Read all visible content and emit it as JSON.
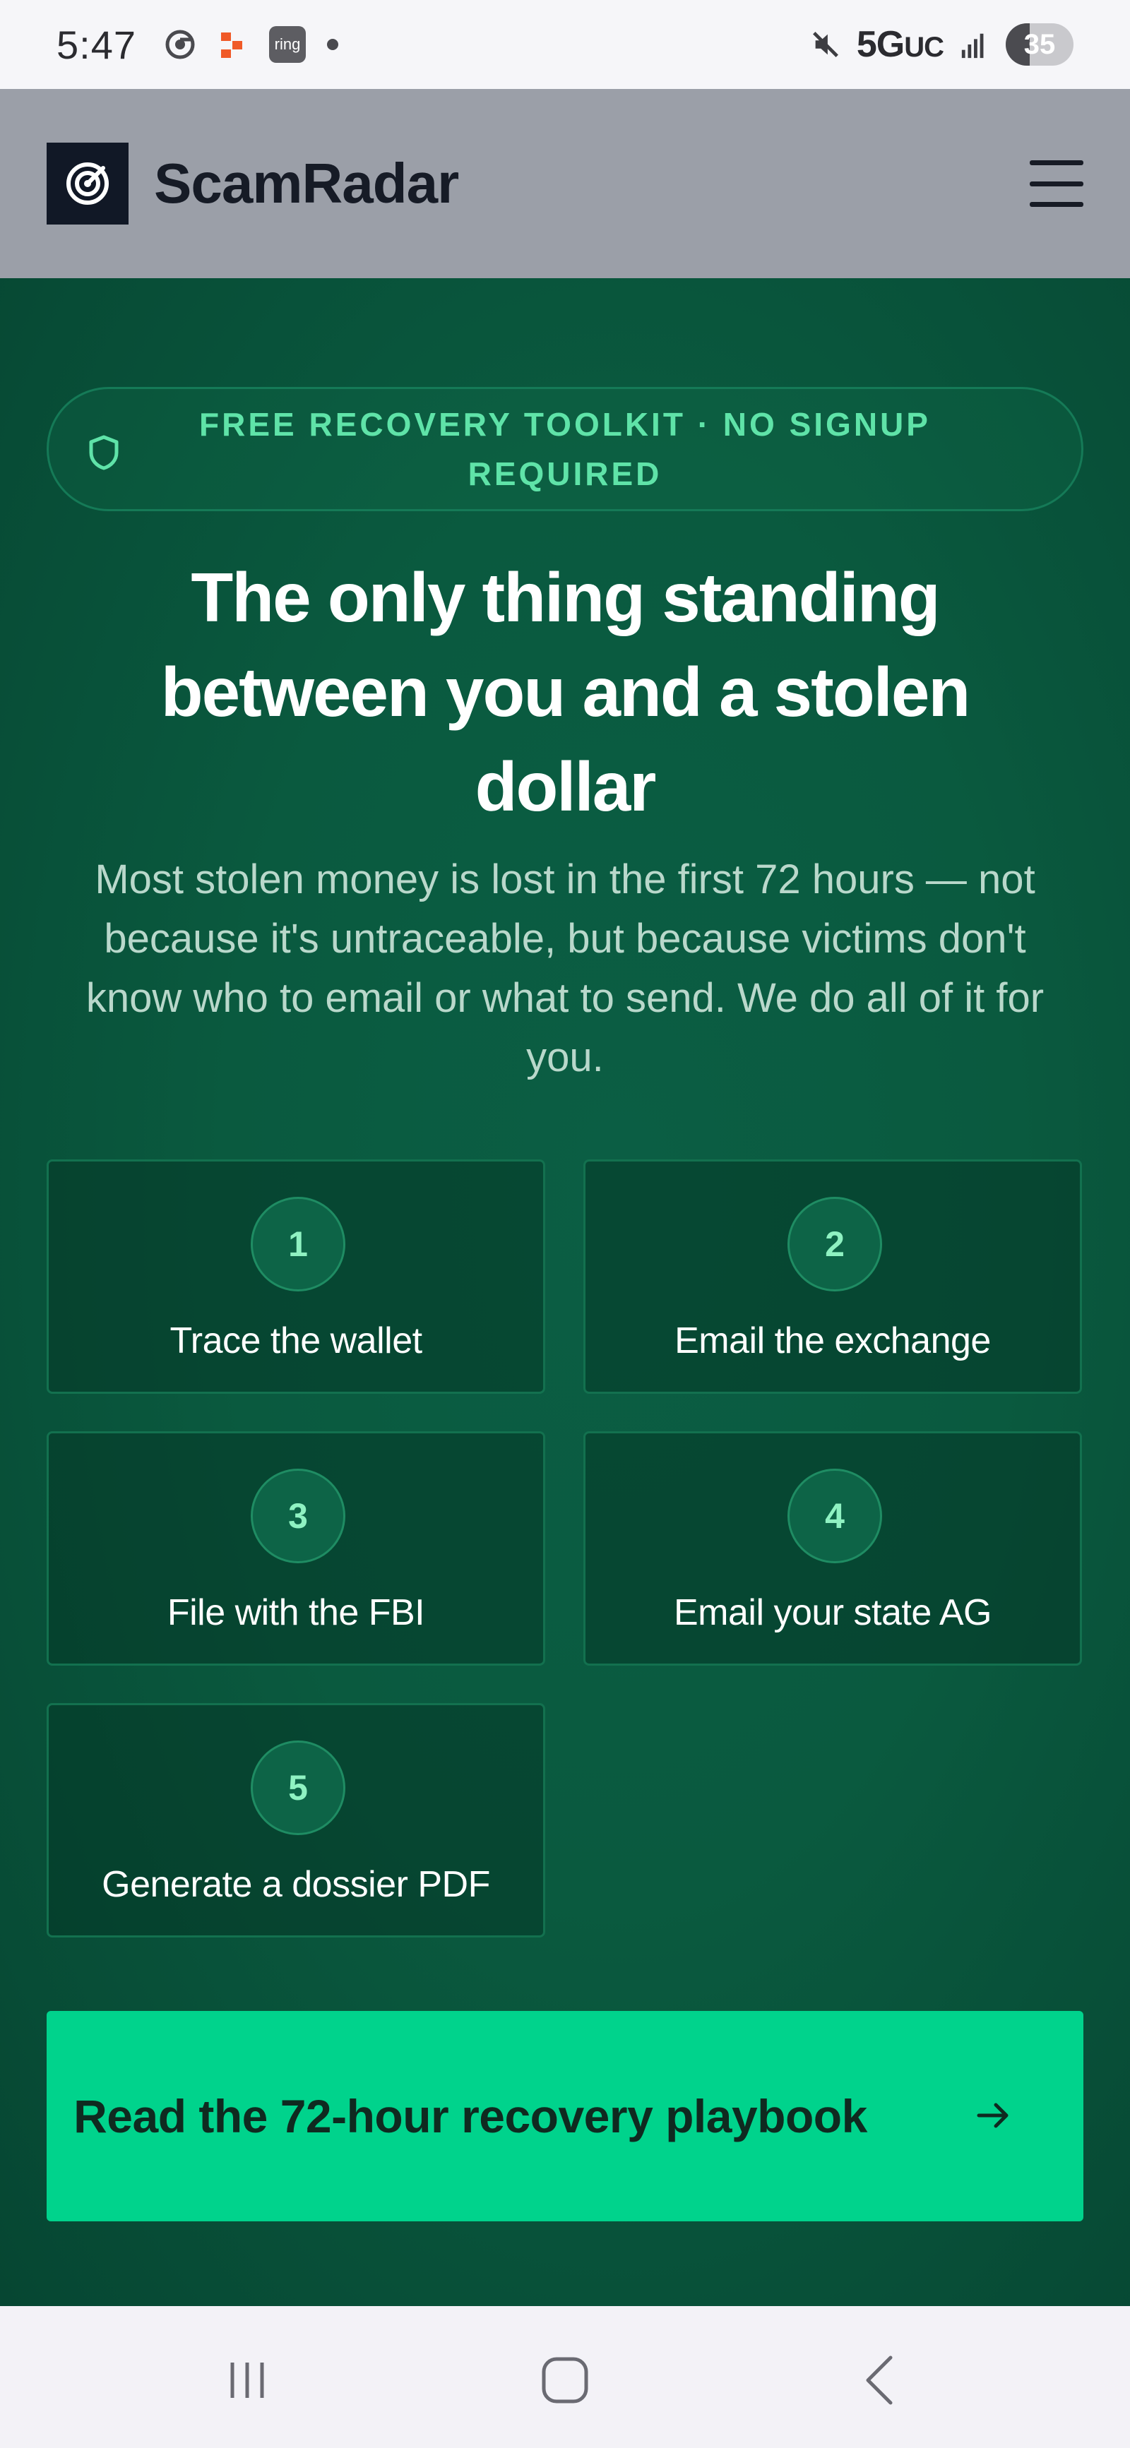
{
  "status_bar": {
    "time": "5:47",
    "ring_label": "ring",
    "network": "5G",
    "network_suffix": "UC",
    "battery": "35",
    "battery_level": 0.35,
    "icons": [
      "chrome-icon",
      "app-notification-icon",
      "ring-app-icon",
      "notification-dot-icon",
      "mute-icon",
      "signal-icon"
    ]
  },
  "header": {
    "brand": "ScamRadar",
    "logo_icon": "radar-icon",
    "menu_icon": "hamburger-menu-icon"
  },
  "hero": {
    "badge": "FREE RECOVERY TOOLKIT · NO SIGNUP REQUIRED",
    "badge_icon": "shield-icon",
    "title": "The only thing standing between you and a stolen dollar",
    "subtitle": "Most stolen money is lost in the first 72 hours — not because it's untraceable, but because victims don't know who to email or what to send. We do all of it for you.",
    "steps": [
      {
        "number": "1",
        "label": "Trace the wallet"
      },
      {
        "number": "2",
        "label": "Email the exchange"
      },
      {
        "number": "3",
        "label": "File with the FBI"
      },
      {
        "number": "4",
        "label": "Email your state AG"
      },
      {
        "number": "5",
        "label": "Generate a dossier PDF"
      }
    ],
    "cta": "Read the 72-hour recovery playbook",
    "cta_icon": "arrow-right-icon"
  },
  "nav_bar": {
    "buttons": [
      "recent-apps-icon",
      "home-icon",
      "back-icon"
    ]
  },
  "colors": {
    "hero_bg": "#0a5a3f",
    "accent": "#00d38c",
    "badge_text": "#5fe3a8",
    "header_bg": "#9b9fa8"
  }
}
